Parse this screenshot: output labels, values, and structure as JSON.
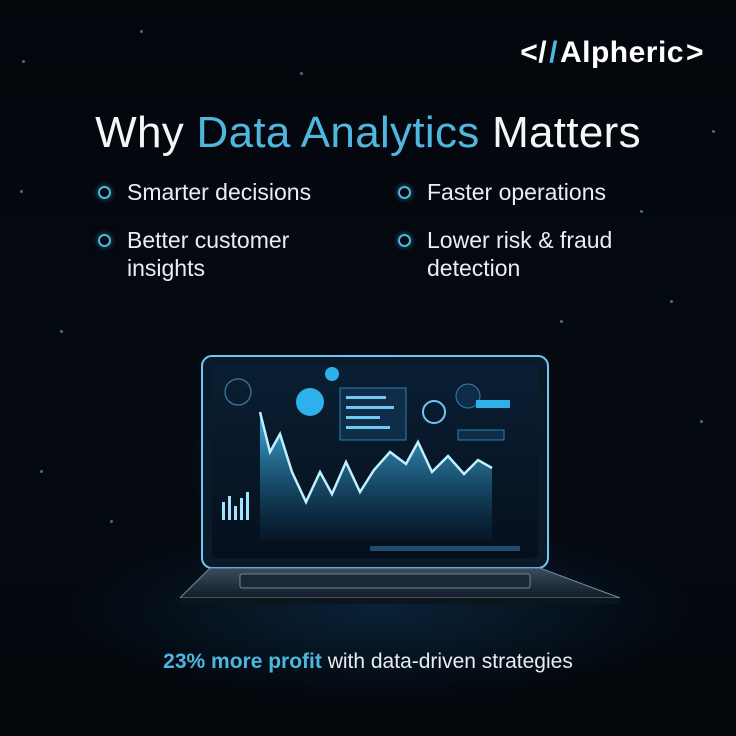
{
  "brand": {
    "logo_text": "Alpheric",
    "logo_prefix": "</",
    "logo_suffix": ">"
  },
  "headline": {
    "part1": "Why ",
    "accent": "Data Analytics",
    "part2": " Matters"
  },
  "benefits": [
    {
      "line1": "Smarter decisions",
      "line2": ""
    },
    {
      "line1": "Faster operations",
      "line2": ""
    },
    {
      "line1": "Better customer",
      "line2": "insights"
    },
    {
      "line1": "Lower risk & fraud",
      "line2": "detection"
    }
  ],
  "tagline": {
    "accent": "23% more profit",
    "rest": " with data-driven strategies"
  },
  "colors": {
    "accent": "#4fb6de",
    "background": "#03060b",
    "text": "#f4f6f8"
  },
  "icons": [
    "ring-bullet-icon",
    "laptop-illustration"
  ]
}
